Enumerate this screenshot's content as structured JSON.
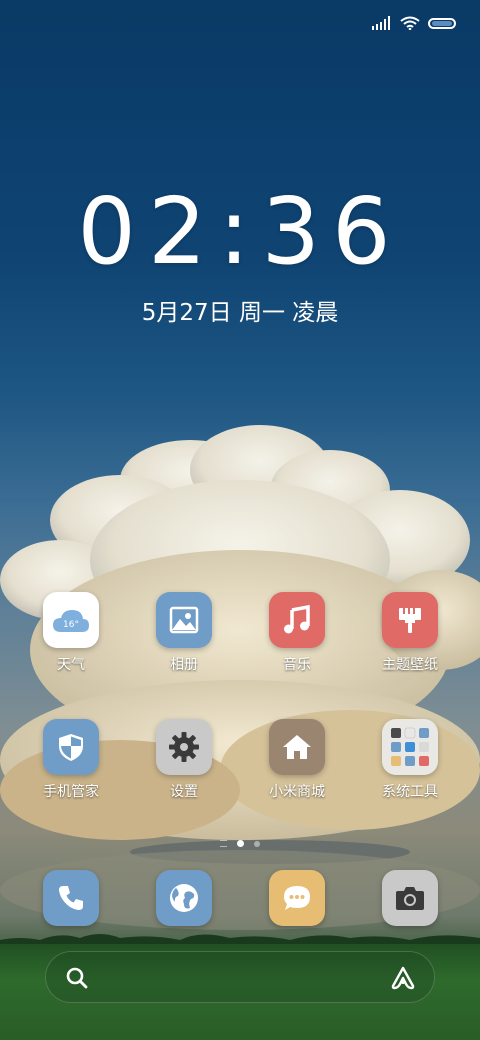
{
  "status_bar": {
    "icons": [
      "signal-icon",
      "wifi-icon",
      "battery-icon"
    ]
  },
  "lockscreen": {
    "time": "02:36",
    "date": "5月27日 周一 凌晨"
  },
  "apps": [
    {
      "label": "天气",
      "icon": "weather-icon",
      "temp": "16°",
      "color": "#ffffff"
    },
    {
      "label": "相册",
      "icon": "gallery-icon",
      "color": "#6f9dc7"
    },
    {
      "label": "音乐",
      "icon": "music-icon",
      "color": "#e06a66"
    },
    {
      "label": "主题壁纸",
      "icon": "themes-icon",
      "color": "#e06a66"
    },
    {
      "label": "手机管家",
      "icon": "security-icon",
      "color": "#6f9dc7"
    },
    {
      "label": "设置",
      "icon": "gear-icon",
      "color": "#c9c9c9"
    },
    {
      "label": "小米商城",
      "icon": "home-store-icon",
      "color": "#9a8670"
    },
    {
      "label": "系统工具",
      "icon": "folder-icon",
      "color": "#e8e8e8"
    }
  ],
  "page_indicator": {
    "pages": 3,
    "active": 1
  },
  "dock": [
    {
      "icon": "phone-icon",
      "color": "#6f9dc7"
    },
    {
      "icon": "browser-icon",
      "color": "#6f9dc7"
    },
    {
      "icon": "messages-icon",
      "color": "#e6bd72"
    },
    {
      "icon": "camera-icon",
      "color": "#c9c9c9"
    }
  ],
  "search": {
    "icons": [
      "search-icon",
      "assistant-icon"
    ]
  }
}
